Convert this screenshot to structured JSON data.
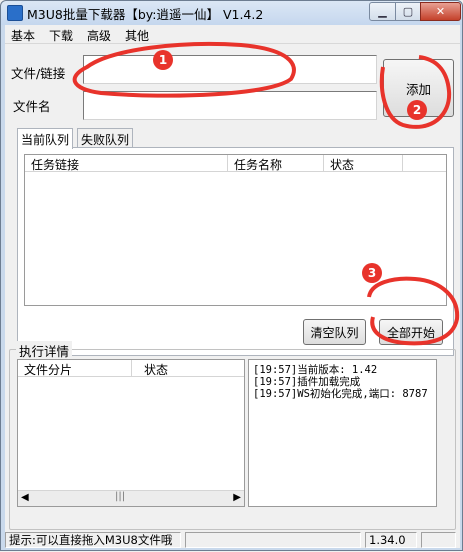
{
  "window": {
    "title": "M3U8批量下载器【by:逍遥一仙】 V1.4.2"
  },
  "menu": [
    "基本",
    "下载",
    "高级",
    "其他"
  ],
  "form": {
    "file_link_label": "文件/链接",
    "file_link_value": "",
    "file_name_label": "文件名",
    "file_name_value": "",
    "add_button": "添加"
  },
  "tabs": [
    "当前队列",
    "失败队列"
  ],
  "queue_table": {
    "columns": [
      "任务链接",
      "任务名称",
      "状态"
    ],
    "rows": []
  },
  "buttons": {
    "clear_queue": "清空队列",
    "start_all": "全部开始"
  },
  "exec_details": {
    "title": "执行详情",
    "columns": [
      "文件分片",
      "状态"
    ],
    "log": [
      "[19:57]当前版本: 1.42",
      "[19:57]插件加载完成",
      "[19:57]WS初始化完成,端口: 8787"
    ]
  },
  "status": {
    "hint": "提示:可以直接拖入M3U8文件哦",
    "version": "1.34.0"
  },
  "annotations": {
    "color": "#e8332b",
    "labels": [
      "1",
      "2",
      "3"
    ]
  }
}
